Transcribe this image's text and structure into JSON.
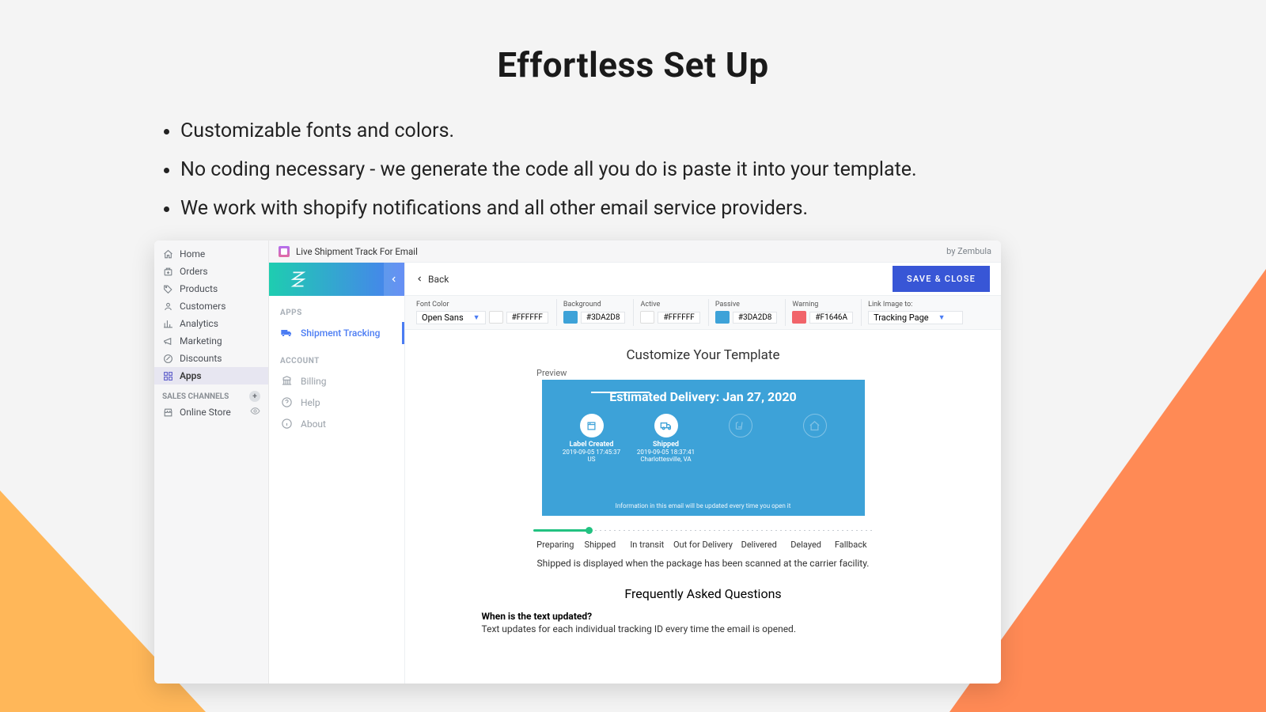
{
  "hero": {
    "title": "Effortless Set Up",
    "bullets": [
      "Customizable fonts and colors.",
      "No coding necessary - we generate the code all you do is paste it into your template.",
      "We work with shopify notifications and all other email service providers."
    ]
  },
  "shopNav": {
    "items": [
      {
        "label": "Home",
        "icon": "home-icon"
      },
      {
        "label": "Orders",
        "icon": "orders-icon"
      },
      {
        "label": "Products",
        "icon": "products-icon"
      },
      {
        "label": "Customers",
        "icon": "customers-icon"
      },
      {
        "label": "Analytics",
        "icon": "analytics-icon"
      },
      {
        "label": "Marketing",
        "icon": "marketing-icon"
      },
      {
        "label": "Discounts",
        "icon": "discounts-icon"
      },
      {
        "label": "Apps",
        "icon": "apps-icon",
        "active": true
      }
    ],
    "salesChannelsLabel": "SALES CHANNELS",
    "salesChannels": [
      {
        "label": "Online Store",
        "icon": "store-icon"
      }
    ]
  },
  "appHeader": {
    "title": "Live Shipment Track For Email",
    "by": "by Zembula"
  },
  "zbSide": {
    "appsLabel": "APPS",
    "apps": [
      {
        "label": "Shipment Tracking",
        "icon": "truck-icon",
        "selected": true
      }
    ],
    "accountLabel": "ACCOUNT",
    "account": [
      {
        "label": "Billing",
        "icon": "billing-icon"
      },
      {
        "label": "Help",
        "icon": "help-icon"
      },
      {
        "label": "About",
        "icon": "info-icon"
      }
    ]
  },
  "topbar": {
    "back": "Back",
    "save": "SAVE & CLOSE"
  },
  "options": {
    "font": {
      "label": "Font Color",
      "font_name": "Open Sans",
      "hex": "#FFFFFF",
      "swatch": "#ffffff"
    },
    "background": {
      "label": "Background",
      "hex": "#3DA2D8",
      "swatch": "#3da2d8"
    },
    "active": {
      "label": "Active",
      "hex": "#FFFFFF",
      "swatch": "#ffffff"
    },
    "passive": {
      "label": "Passive",
      "hex": "#3DA2D8",
      "swatch": "#3da2d8"
    },
    "warning": {
      "label": "Warning",
      "hex": "#F1646A",
      "swatch": "#f1646a"
    },
    "link": {
      "label": "Link Image to:",
      "value": "Tracking Page"
    }
  },
  "template": {
    "heading": "Customize Your Template",
    "preview_label": "Preview",
    "preview": {
      "title": "Estimated Delivery: Jan 27, 2020",
      "nodes": [
        {
          "label": "Label Created",
          "line1": "2019-09-05 17:45:37",
          "line2": "US"
        },
        {
          "label": "Shipped",
          "line1": "2019-09-05 18:37:41",
          "line2": "Charlottesville, VA"
        },
        {
          "ghost": true
        },
        {
          "ghost": true
        }
      ],
      "footnote": "Information in this email will be updated every time you open it"
    },
    "states": [
      "Preparing",
      "Shipped",
      "In transit",
      "Out for Delivery",
      "Delivered",
      "Delayed",
      "Fallback"
    ],
    "states_flex": [
      1,
      1,
      1.1,
      1.4,
      1.1,
      1,
      1
    ],
    "state_desc": "Shipped is displayed when the package has been scanned at the carrier facility."
  },
  "faq": {
    "heading": "Frequently Asked Questions",
    "q1": "When is the text updated?",
    "a1": "Text updates for each individual tracking ID every time the email is opened."
  }
}
